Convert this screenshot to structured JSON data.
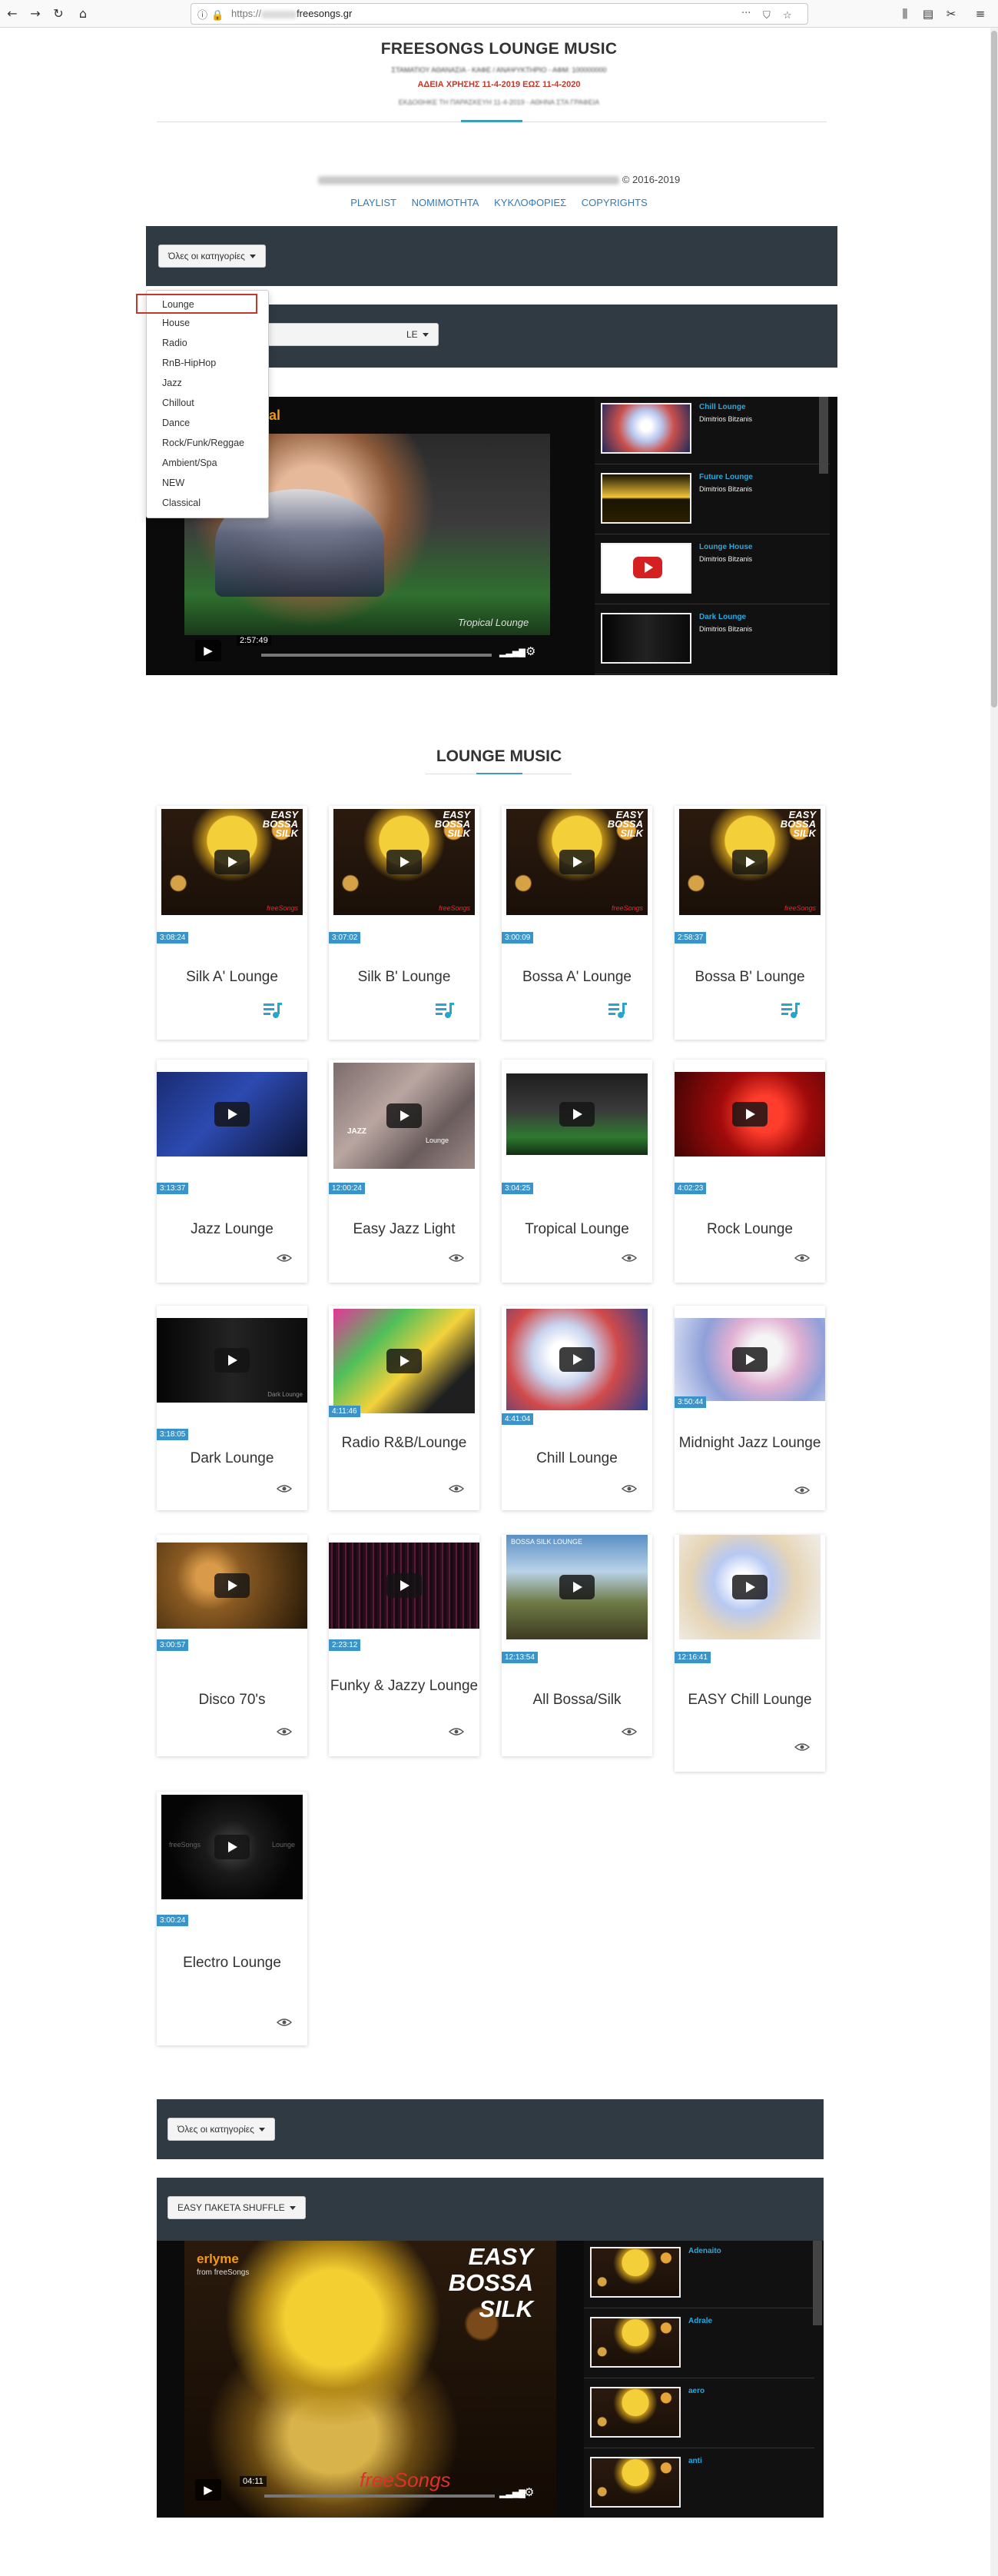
{
  "browser": {
    "url_protocol": "https://",
    "url_host": "freesongs.gr",
    "icons": [
      "back-icon",
      "forward-icon",
      "reload-icon",
      "home-icon",
      "more-icon",
      "pocket-icon",
      "bookmark-star-icon",
      "library-icon",
      "sidebar-icon",
      "screenshot-icon",
      "menu-icon"
    ]
  },
  "header": {
    "title": "FREESONGS LOUNGE MUSIC",
    "line1": "ΣΤΑΜΑΤΙΟΥ ΑΘΑΝΑΣΙΑ - ΚΑΦΕ / ΑΝΑΨΥΚΤΗΡΙΟ - ΑΦΜ: 100000000",
    "license": "ΑΔΕΙΑ ΧΡΗΣΗΣ 11-4-2019 ΕΩΣ 11-4-2020",
    "line2": "ΕΚΔΟΘΗΚΕ ΤΗ ΠΑΡΑΣΚΕΥΗ 11-4-2019 - ΑΘΗΝΑ ΣΤΑ ΓΡΑΦΕΙΑ"
  },
  "copyright": "© 2016-2019",
  "nav": [
    "PLAYLIST",
    "ΝΟΜΙΜΟΤΗΤΑ",
    "ΚΥΚΛΟΦΟΡΙΕΣ",
    "COPYRIGHTS"
  ],
  "filter1": {
    "label": "Όλες οι κατηγορίες"
  },
  "filter2": {
    "label_suffix": "LE"
  },
  "dropdown": {
    "items": [
      "Lounge",
      "House",
      "Radio",
      "RnB-HipHop",
      "Jazz",
      "Chillout",
      "Dance",
      "Rock/Funk/Reggae",
      "Ambient/Spa",
      "NEW",
      "Classical"
    ]
  },
  "player1": {
    "title": "ropical",
    "overlay_text": "Tropical Lounge",
    "time": "2:57:49",
    "playlist": [
      {
        "name": "Chill Lounge",
        "author": "Dimitrios Bitzanis"
      },
      {
        "name": "Future Lounge",
        "author": "Dimitrios Bitzanis"
      },
      {
        "name": "Lounge House",
        "author": "Dimitrios Bitzanis"
      },
      {
        "name": "Dark Lounge",
        "author": "Dimitrios Bitzanis"
      }
    ]
  },
  "section_title": "LOUNGE MUSIC",
  "thumb_text": {
    "easy": "EASY",
    "bossa": "BOSSA",
    "silk": "SILK",
    "freesongs": "freeSongs",
    "dark_lounge": "Dark Lounge",
    "bossa_silk_lounge": "BOSSA SILK LOUNGE",
    "jazz": "JAZZ",
    "lounge": "Lounge"
  },
  "cards": [
    {
      "title": "Silk A' Lounge",
      "duration": "3:08:24",
      "icon": "playlist-icon"
    },
    {
      "title": "Silk B' Lounge",
      "duration": "3:07:02",
      "icon": "playlist-icon"
    },
    {
      "title": "Bossa A' Lounge",
      "duration": "3:00:09",
      "icon": "playlist-icon"
    },
    {
      "title": "Bossa B' Lounge",
      "duration": "2:58:37",
      "icon": "playlist-icon"
    },
    {
      "title": "Jazz Lounge",
      "duration": "3:13:37",
      "icon": "eye-icon"
    },
    {
      "title": "Easy Jazz Light",
      "duration": "12:00:24",
      "icon": "eye-icon"
    },
    {
      "title": "Tropical Lounge",
      "duration": "3:04:25",
      "icon": "eye-icon"
    },
    {
      "title": "Rock Lounge",
      "duration": "4:02:23",
      "icon": "eye-icon"
    },
    {
      "title": "Dark Lounge",
      "duration": "3:18:05",
      "icon": "eye-icon"
    },
    {
      "title": "Radio R&B/Lounge",
      "duration": "4:11:46",
      "icon": "eye-icon"
    },
    {
      "title": "Chill Lounge",
      "duration": "4:41:04",
      "icon": "eye-icon"
    },
    {
      "title": "Midnight Jazz Lounge",
      "duration": "3:50:44",
      "icon": "eye-icon"
    },
    {
      "title": "Disco 70's",
      "duration": "3:00:57",
      "icon": "eye-icon"
    },
    {
      "title": "Funky & Jazzy Lounge",
      "duration": "2:23:12",
      "icon": "eye-icon"
    },
    {
      "title": "All Bossa/Silk",
      "duration": "12:13:54",
      "icon": "eye-icon"
    },
    {
      "title": "EASY Chill Lounge",
      "duration": "12:16:41",
      "icon": "eye-icon"
    },
    {
      "title": "Electro Lounge",
      "duration": "3:00:24",
      "icon": "eye-icon"
    }
  ],
  "filter3": {
    "label": "Όλες οι κατηγορίες"
  },
  "filter4": {
    "label": "EASY ΠΑΚΕΤΑ SHUFFLE"
  },
  "player2": {
    "brand": "erlyme",
    "brand_sub": "from freeSongs",
    "big_text": "EASY BOSSA SILK",
    "watermark": "freeSongs",
    "time": "04:11",
    "playlist": [
      {
        "name": "Adenaito"
      },
      {
        "name": "Adrale"
      },
      {
        "name": "aero"
      },
      {
        "name": "anti"
      }
    ]
  },
  "colors": {
    "accent": "#3d9fbd",
    "link": "#337ab7",
    "dark_bar": "#2f3a42",
    "license_red": "#c0392b",
    "duration_badge": "#3a93c9",
    "playlist_link": "#29a9e0"
  }
}
